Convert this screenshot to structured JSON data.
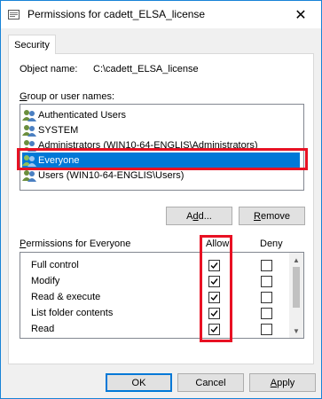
{
  "window": {
    "title": "Permissions for cadett_ELSA_license",
    "close": "✕"
  },
  "tab": {
    "label": "Security"
  },
  "object": {
    "label": "Object name:",
    "value": "C:\\cadett_ELSA_license"
  },
  "group": {
    "label_underlined": "G",
    "label_rest": "roup or user names:",
    "items": [
      {
        "label": "Authenticated Users"
      },
      {
        "label": "SYSTEM"
      },
      {
        "label": "Administrators (WIN10-64-ENGLIS\\Administrators)"
      },
      {
        "label": "Everyone",
        "selected": true
      },
      {
        "label": "Users (WIN10-64-ENGLIS\\Users)"
      }
    ]
  },
  "buttons": {
    "add_u": "d",
    "add_pre": "A",
    "add_post": "d...",
    "remove_u": "R",
    "remove_rest": "emove",
    "ok": "OK",
    "cancel": "Cancel",
    "apply_u": "A",
    "apply_rest": "pply"
  },
  "permissions": {
    "title_u": "P",
    "title_rest": "ermissions for Everyone",
    "allow": "Allow",
    "deny": "Deny",
    "rows": [
      {
        "name": "Full control",
        "allow": true,
        "deny": false
      },
      {
        "name": "Modify",
        "allow": true,
        "deny": false
      },
      {
        "name": "Read & execute",
        "allow": true,
        "deny": false
      },
      {
        "name": "List folder contents",
        "allow": true,
        "deny": false
      },
      {
        "name": "Read",
        "allow": true,
        "deny": false
      }
    ]
  },
  "colors": {
    "selection": "#0078d7",
    "highlight": "#e81123",
    "border_accent": "#1883d7"
  }
}
